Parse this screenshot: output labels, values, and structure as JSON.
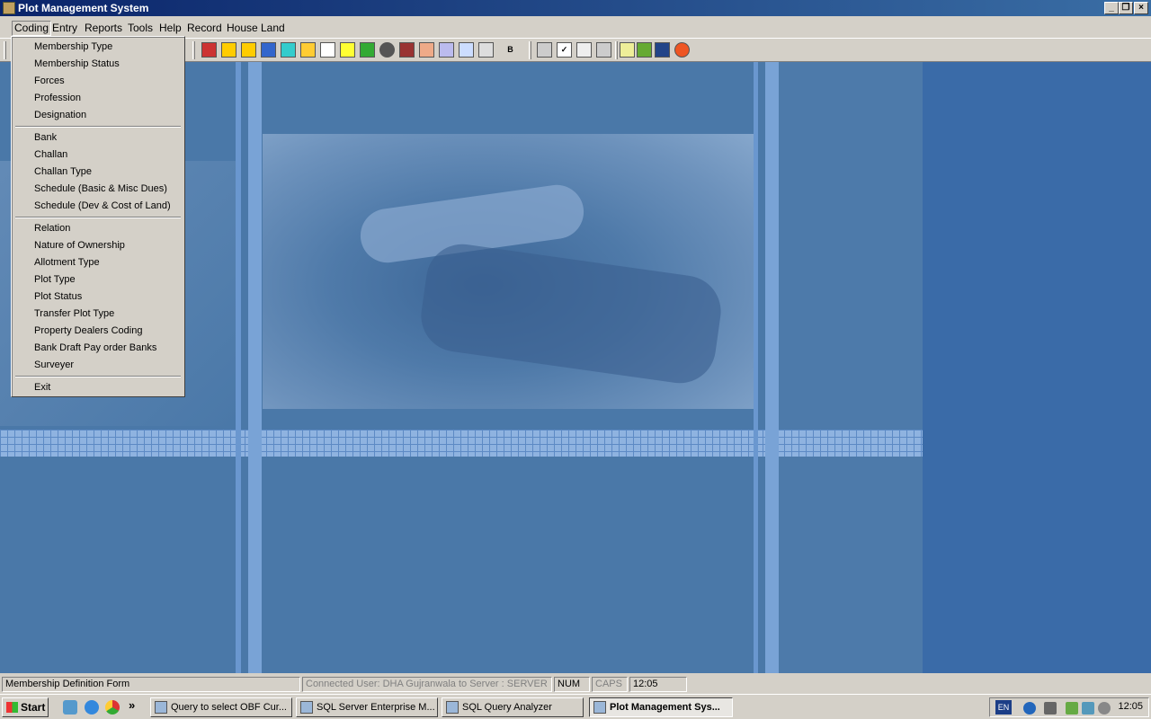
{
  "window": {
    "title": "Plot Management System",
    "controls": [
      "minimize-icon",
      "restore-icon",
      "close-icon"
    ]
  },
  "menubar": {
    "items": [
      "Coding",
      "Entry",
      "Reports",
      "Tools",
      "Help",
      "Record",
      "House",
      "Land"
    ]
  },
  "toolbar": {
    "b_label": "B"
  },
  "coding_menu": {
    "items": [
      "Membership Type",
      "Membership Status",
      "Forces",
      "Profession",
      "Designation",
      "Bank",
      "Challan",
      "Challan Type",
      "Schedule (Basic & Misc Dues)",
      "Schedule (Dev & Cost of Land)",
      "Relation",
      "Nature of Ownership",
      "Allotment Type",
      "Plot Type",
      "Plot Status",
      "Transfer Plot Type",
      "Property Dealers Coding",
      "Bank Draft Pay order Banks",
      "Surveyer",
      "Exit"
    ]
  },
  "statusbar": {
    "form": "Membership Definition Form",
    "connection": "Connected User: DHA Gujranwala to Server : SERVER",
    "num": "NUM",
    "caps": "CAPS",
    "time": "12:05"
  },
  "taskbar": {
    "start": "Start",
    "overflow": "»",
    "tasks": [
      "Query to select OBF Cur...",
      "SQL Server Enterprise M...",
      "SQL Query Analyzer",
      "Plot Management Sys..."
    ],
    "lang": "EN",
    "clock": "12:05"
  },
  "colors": {
    "titlebar": "#0a246a",
    "workspace": "#3a6ba8",
    "chrome": "#d4d0c8"
  }
}
